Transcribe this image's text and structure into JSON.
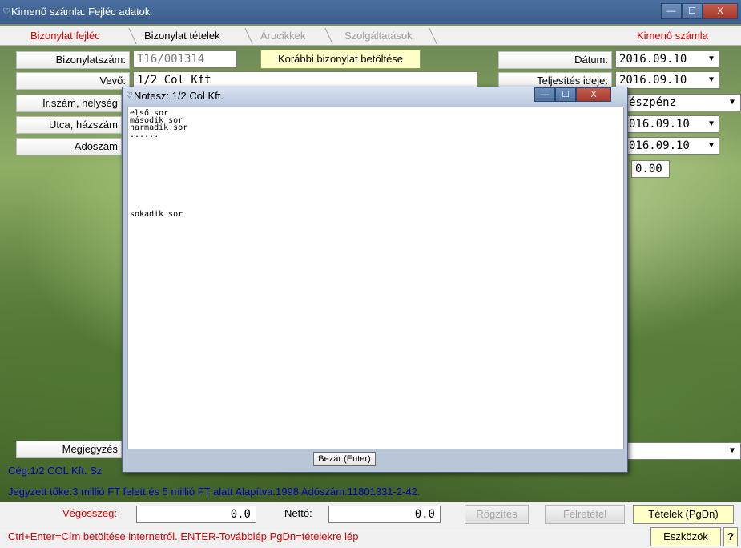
{
  "window": {
    "title": "Kimenő számla: Fejléc adatok",
    "min_label": "—",
    "max_label": "☐",
    "close_label": "X"
  },
  "tabs": [
    {
      "label": "Bizonylat fejléc",
      "state": "active"
    },
    {
      "label": "Bizonylat tételek",
      "state": "normal"
    },
    {
      "label": "Árucikkek",
      "state": "disabled"
    },
    {
      "label": "Szolgáltatások",
      "state": "disabled"
    }
  ],
  "header_right": "Kimenő számla",
  "form": {
    "bizonylatszam_label": "Bizonylatszám:",
    "bizonylatszam_value": "T16/001314",
    "load_prev_button": "Korábbi bizonylat betöltése",
    "vevo_label": "Vevő:",
    "vevo_value": "1/2 Col Kft",
    "irszam_label": "Ir.szám, helység",
    "utca_label": "Utca, házszám",
    "adoszam_label": "Adószám",
    "megjegyzes_label": "Megjegyzés",
    "datum_label": "Dátum:",
    "datum_value": "2016.09.10",
    "teljesites_label": "Teljesítés ideje:",
    "teljesites_value": "2016.09.10",
    "fizmod_value": "észpénz",
    "date3_value": "016.09.10",
    "date4_value": "016.09.10",
    "amount_value": "0.00"
  },
  "dialog": {
    "title": "Notesz: 1/2 Col Kft.",
    "lines": [
      "első sor",
      "második sor",
      "harmadik sor",
      "......",
      "",
      "",
      "",
      "",
      "",
      "",
      "",
      "",
      "",
      "",
      "sokadik sor"
    ],
    "close_button": "Bezár (Enter)"
  },
  "info": {
    "line1": "Cég:1/2 COL Kft.  Sz",
    "line2": "Jegyzett tőke:3 millió FT felett és 5 millió FT alatt  Alapítva:1998  Adószám:11801331-2-42."
  },
  "totals": {
    "vegosszeg_label": "Végösszeg:",
    "vegosszeg_value": "0.0",
    "netto_label": "Nettó:",
    "netto_value": "0.0"
  },
  "buttons": {
    "rogzites": "Rögzítés",
    "felretetel": "Félretétel",
    "tetelek": "Tételek (PgDn)",
    "eszkozok": "Eszközök",
    "help": "?"
  },
  "statusbar": "Ctrl+Enter=Cím betöltése internetről.  ENTER-Továbblép  PgDn=tételekre lép",
  "colors": {
    "active_tab": "#e00000",
    "info_text": "#0000c0",
    "status_text": "#e00000"
  },
  "icons": {
    "window": "heart-shield-icon",
    "dropdown": "triangle-down-icon"
  }
}
